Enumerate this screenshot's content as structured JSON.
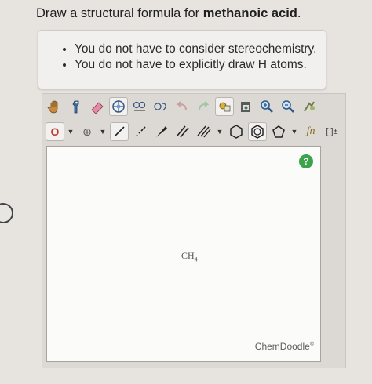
{
  "question": {
    "prefix": "Draw a structural formula for ",
    "compound": "methanoic acid",
    "suffix": "."
  },
  "notes": [
    "You do not have to consider stereochemistry.",
    "You do not have to explicitly draw H atoms."
  ],
  "toolbar": {
    "element_symbol": "O",
    "charge_symbol": "⊕",
    "sn_label": "ʃn",
    "bracket_label": "[ ]±"
  },
  "canvas": {
    "molecule_main": "CH",
    "molecule_sub": "4",
    "help_label": "?",
    "brand": "ChemDoodle",
    "brand_mark": "®"
  },
  "colors": {
    "element_red": "#c0392b",
    "help_green": "#3ba34a"
  }
}
